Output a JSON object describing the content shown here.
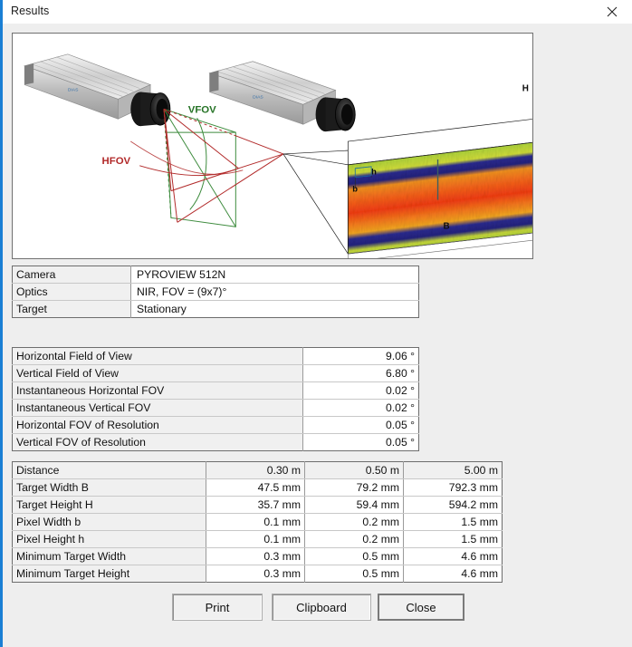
{
  "window": {
    "title": "Results",
    "accent_color": "#1a7fd4",
    "close_icon": "close-icon"
  },
  "diagram": {
    "labels": {
      "vfov": "VFOV",
      "hfov": "HFOV",
      "target_height": "H",
      "target_width": "B",
      "pixel_width": "b",
      "pixel_height": "h"
    },
    "colors": {
      "vfov": "#3d8b3d",
      "hfov": "#b22a2a",
      "outline": "#1a1a1a"
    }
  },
  "table_camera": {
    "rows": [
      {
        "label": "Camera",
        "value": "PYROVIEW 512N"
      },
      {
        "label": "Optics",
        "value": "NIR, FOV = (9x7)°"
      },
      {
        "label": "Target",
        "value": "Stationary"
      }
    ]
  },
  "table_fov": {
    "rows": [
      {
        "label": "Horizontal Field of View",
        "value": "9.06 °"
      },
      {
        "label": "Vertical Field of View",
        "value": "6.80 °"
      },
      {
        "label": "Instantaneous Horizontal FOV",
        "value": "0.02 °"
      },
      {
        "label": "Instantaneous Vertical FOV",
        "value": "0.02 °"
      },
      {
        "label": "Horizontal FOV of Resolution",
        "value": "0.05 °"
      },
      {
        "label": "Vertical FOV of Resolution",
        "value": "0.05 °"
      }
    ]
  },
  "table_distance": {
    "header": {
      "label": "Distance",
      "c1": "0.30 m",
      "c2": "0.50 m",
      "c3": "5.00 m"
    },
    "rows": [
      {
        "label": "Target Width B",
        "c1": "47.5 mm",
        "c2": "79.2 mm",
        "c3": "792.3 mm"
      },
      {
        "label": "Target Height H",
        "c1": "35.7 mm",
        "c2": "59.4 mm",
        "c3": "594.2 mm"
      },
      {
        "label": "Pixel Width b",
        "c1": "0.1 mm",
        "c2": "0.2 mm",
        "c3": "1.5 mm"
      },
      {
        "label": "Pixel Height h",
        "c1": "0.1 mm",
        "c2": "0.2 mm",
        "c3": "1.5 mm"
      },
      {
        "label": "Minimum Target Width",
        "c1": "0.3 mm",
        "c2": "0.5 mm",
        "c3": "4.6 mm"
      },
      {
        "label": "Minimum Target Height",
        "c1": "0.3 mm",
        "c2": "0.5 mm",
        "c3": "4.6 mm"
      }
    ]
  },
  "buttons": {
    "print": "Print",
    "clipboard": "Clipboard",
    "close": "Close"
  }
}
